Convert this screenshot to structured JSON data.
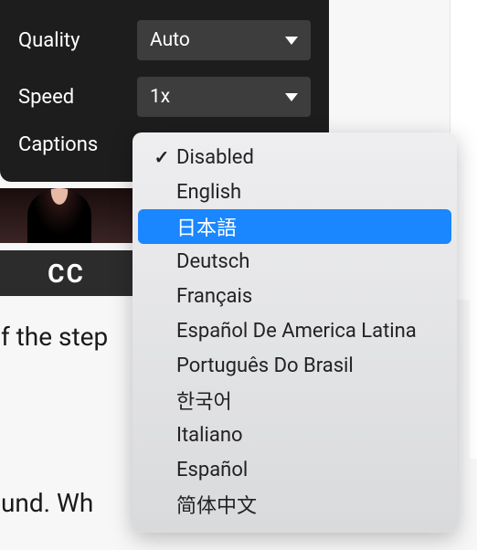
{
  "settings": {
    "quality_label": "Quality",
    "quality_value": "Auto",
    "speed_label": "Speed",
    "speed_value": "1x",
    "captions_label": "Captions"
  },
  "cc_badge": "CC",
  "body_text_1": "of the step",
  "body_text_2": "ound. Wh",
  "captions_options": [
    {
      "label": "Disabled",
      "checked": true,
      "highlighted": false
    },
    {
      "label": "English",
      "checked": false,
      "highlighted": false
    },
    {
      "label": "日本語",
      "checked": false,
      "highlighted": true
    },
    {
      "label": "Deutsch",
      "checked": false,
      "highlighted": false
    },
    {
      "label": "Français",
      "checked": false,
      "highlighted": false
    },
    {
      "label": "Español De America Latina",
      "checked": false,
      "highlighted": false
    },
    {
      "label": "Português Do Brasil",
      "checked": false,
      "highlighted": false
    },
    {
      "label": "한국어",
      "checked": false,
      "highlighted": false
    },
    {
      "label": "Italiano",
      "checked": false,
      "highlighted": false
    },
    {
      "label": "Español",
      "checked": false,
      "highlighted": false
    },
    {
      "label": "简体中文",
      "checked": false,
      "highlighted": false
    }
  ]
}
